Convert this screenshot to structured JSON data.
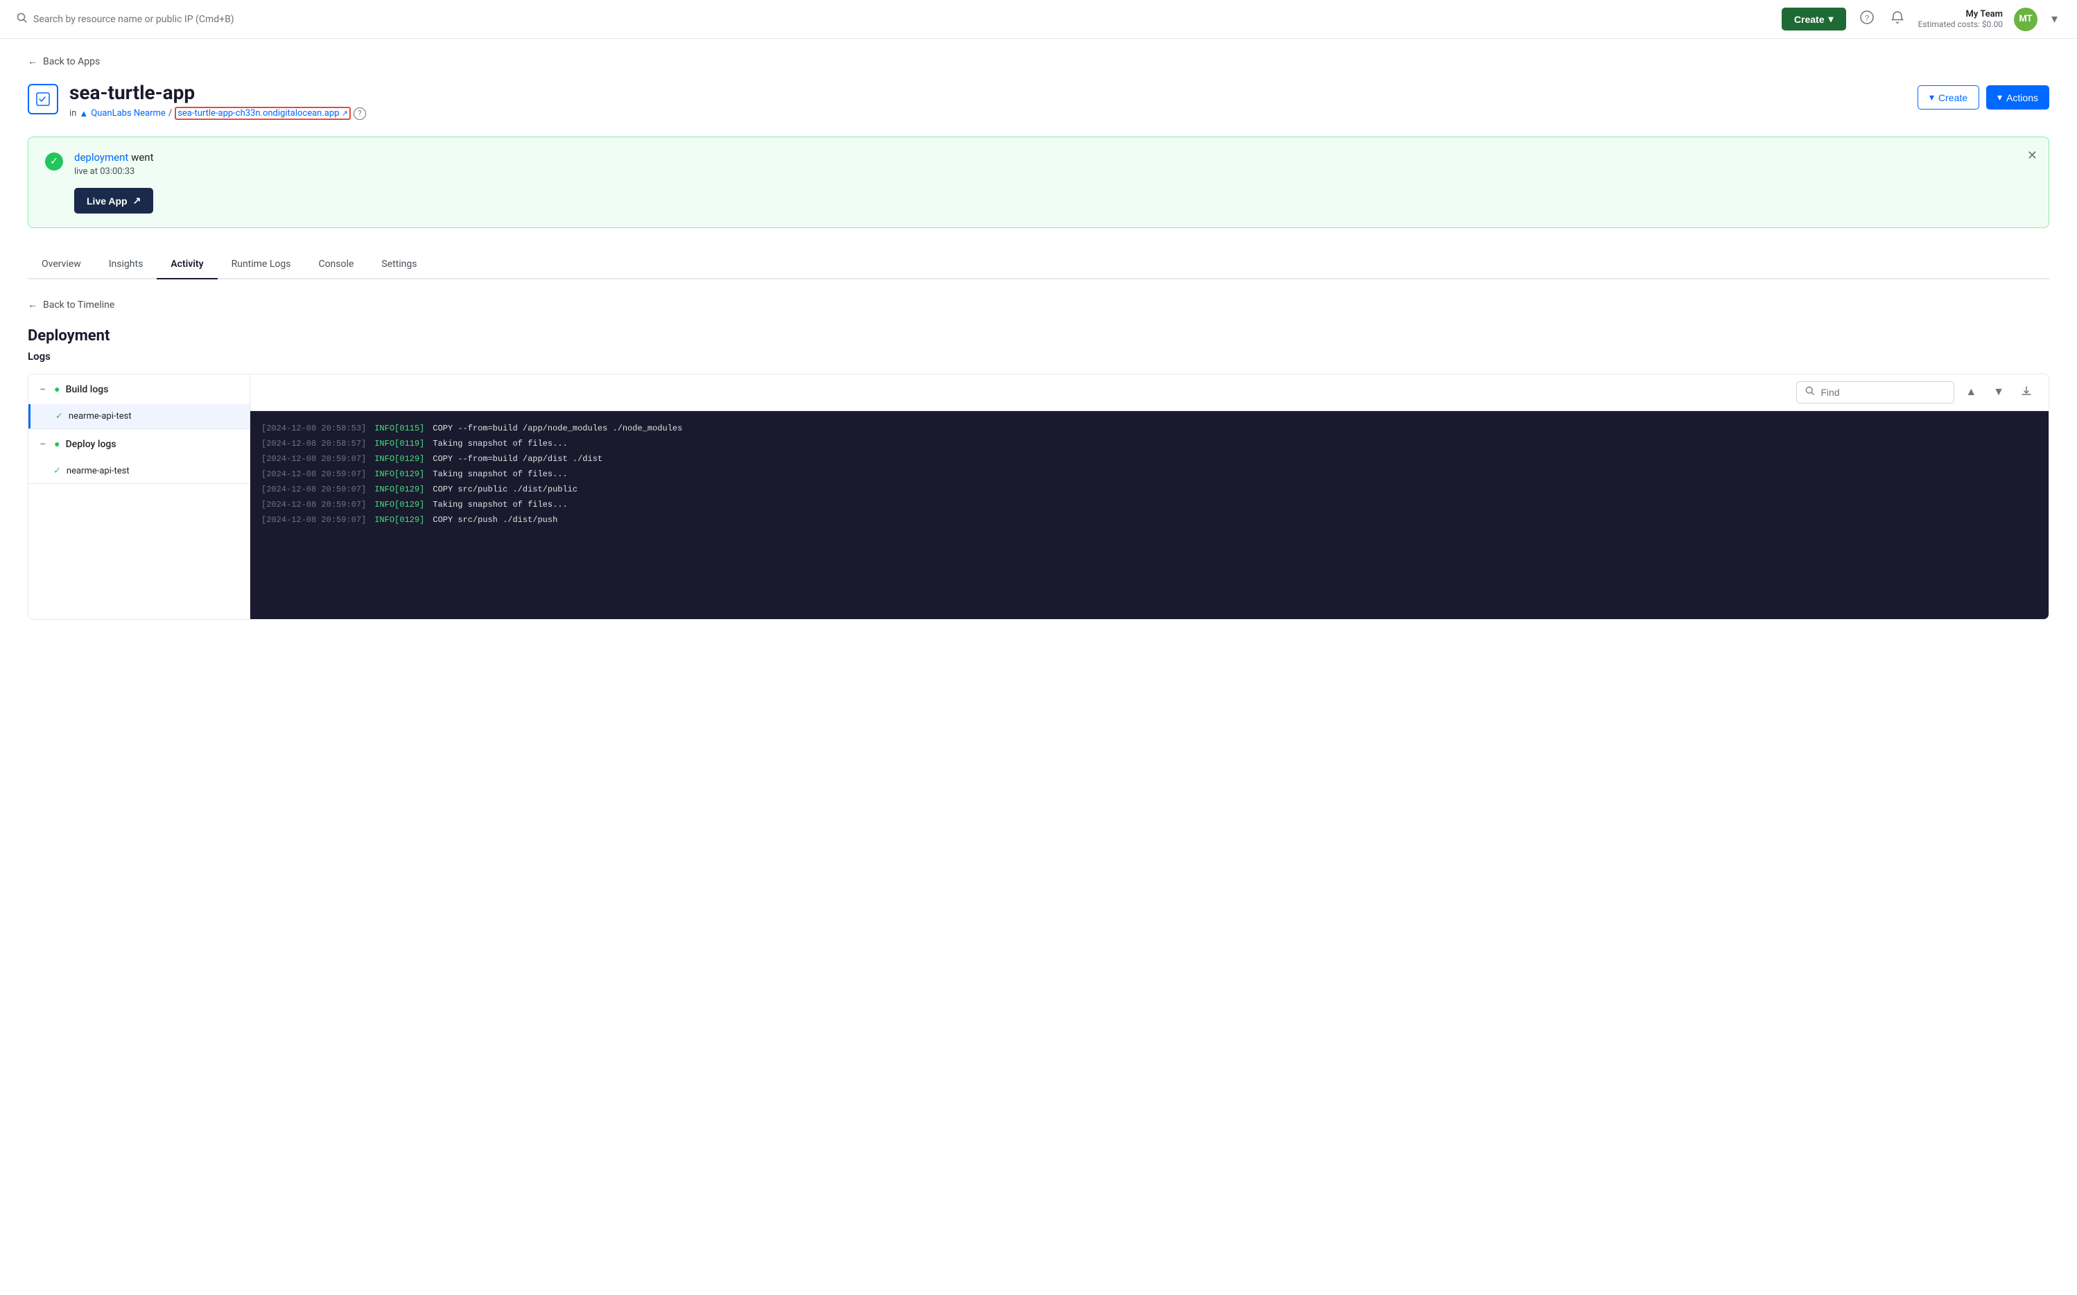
{
  "topNav": {
    "search_placeholder": "Search by resource name or public IP (Cmd+B)",
    "create_label": "Create",
    "team_name": "My Team",
    "estimated_costs": "Estimated costs: $0.00",
    "avatar_initials": "MT"
  },
  "breadcrumb": {
    "back_label": "Back to Apps"
  },
  "appHeader": {
    "app_name": "sea-turtle-app",
    "in_label": "in",
    "team_link": "QuanLabs Nearme",
    "app_link": "sea-turtle-app-ch33n.ondigitalocean.app",
    "create_label": "Create",
    "actions_label": "Actions"
  },
  "banner": {
    "deployment_link": "deployment",
    "went_text": " went",
    "live_time": "live at  03:00:33",
    "live_app_label": "Live App"
  },
  "tabs": {
    "items": [
      {
        "label": "Overview",
        "active": false
      },
      {
        "label": "Insights",
        "active": false
      },
      {
        "label": "Activity",
        "active": true
      },
      {
        "label": "Runtime Logs",
        "active": false
      },
      {
        "label": "Console",
        "active": false
      },
      {
        "label": "Settings",
        "active": false
      }
    ]
  },
  "backTimeline": {
    "label": "Back to Timeline"
  },
  "deployment": {
    "title": "Deployment",
    "logs_label": "Logs",
    "build_logs_label": "Build logs",
    "deploy_logs_label": "Deploy logs",
    "build_item": "nearme-api-test",
    "deploy_item": "nearme-api-test",
    "find_placeholder": "Find"
  },
  "terminalLogs": [
    {
      "time": "[2024-12-08 20:58:53]",
      "level": "INFO[0115]",
      "msg": "COPY --from=build /app/node_modules ./node_modules"
    },
    {
      "time": "[2024-12-08 20:58:57]",
      "level": "INFO[0119]",
      "msg": "Taking snapshot of files..."
    },
    {
      "time": "[2024-12-08 20:59:07]",
      "level": "INFO[0129]",
      "msg": "COPY --from=build /app/dist ./dist"
    },
    {
      "time": "[2024-12-08 20:59:07]",
      "level": "INFO[0129]",
      "msg": "Taking snapshot of files..."
    },
    {
      "time": "[2024-12-08 20:59:07]",
      "level": "INFO[0129]",
      "msg": "COPY src/public ./dist/public"
    },
    {
      "time": "[2024-12-08 20:59:07]",
      "level": "INFO[0129]",
      "msg": "Taking snapshot of files..."
    },
    {
      "time": "[2024-12-08 20:59:07]",
      "level": "INFO[0129]",
      "msg": "COPY src/push ./dist/push"
    }
  ]
}
